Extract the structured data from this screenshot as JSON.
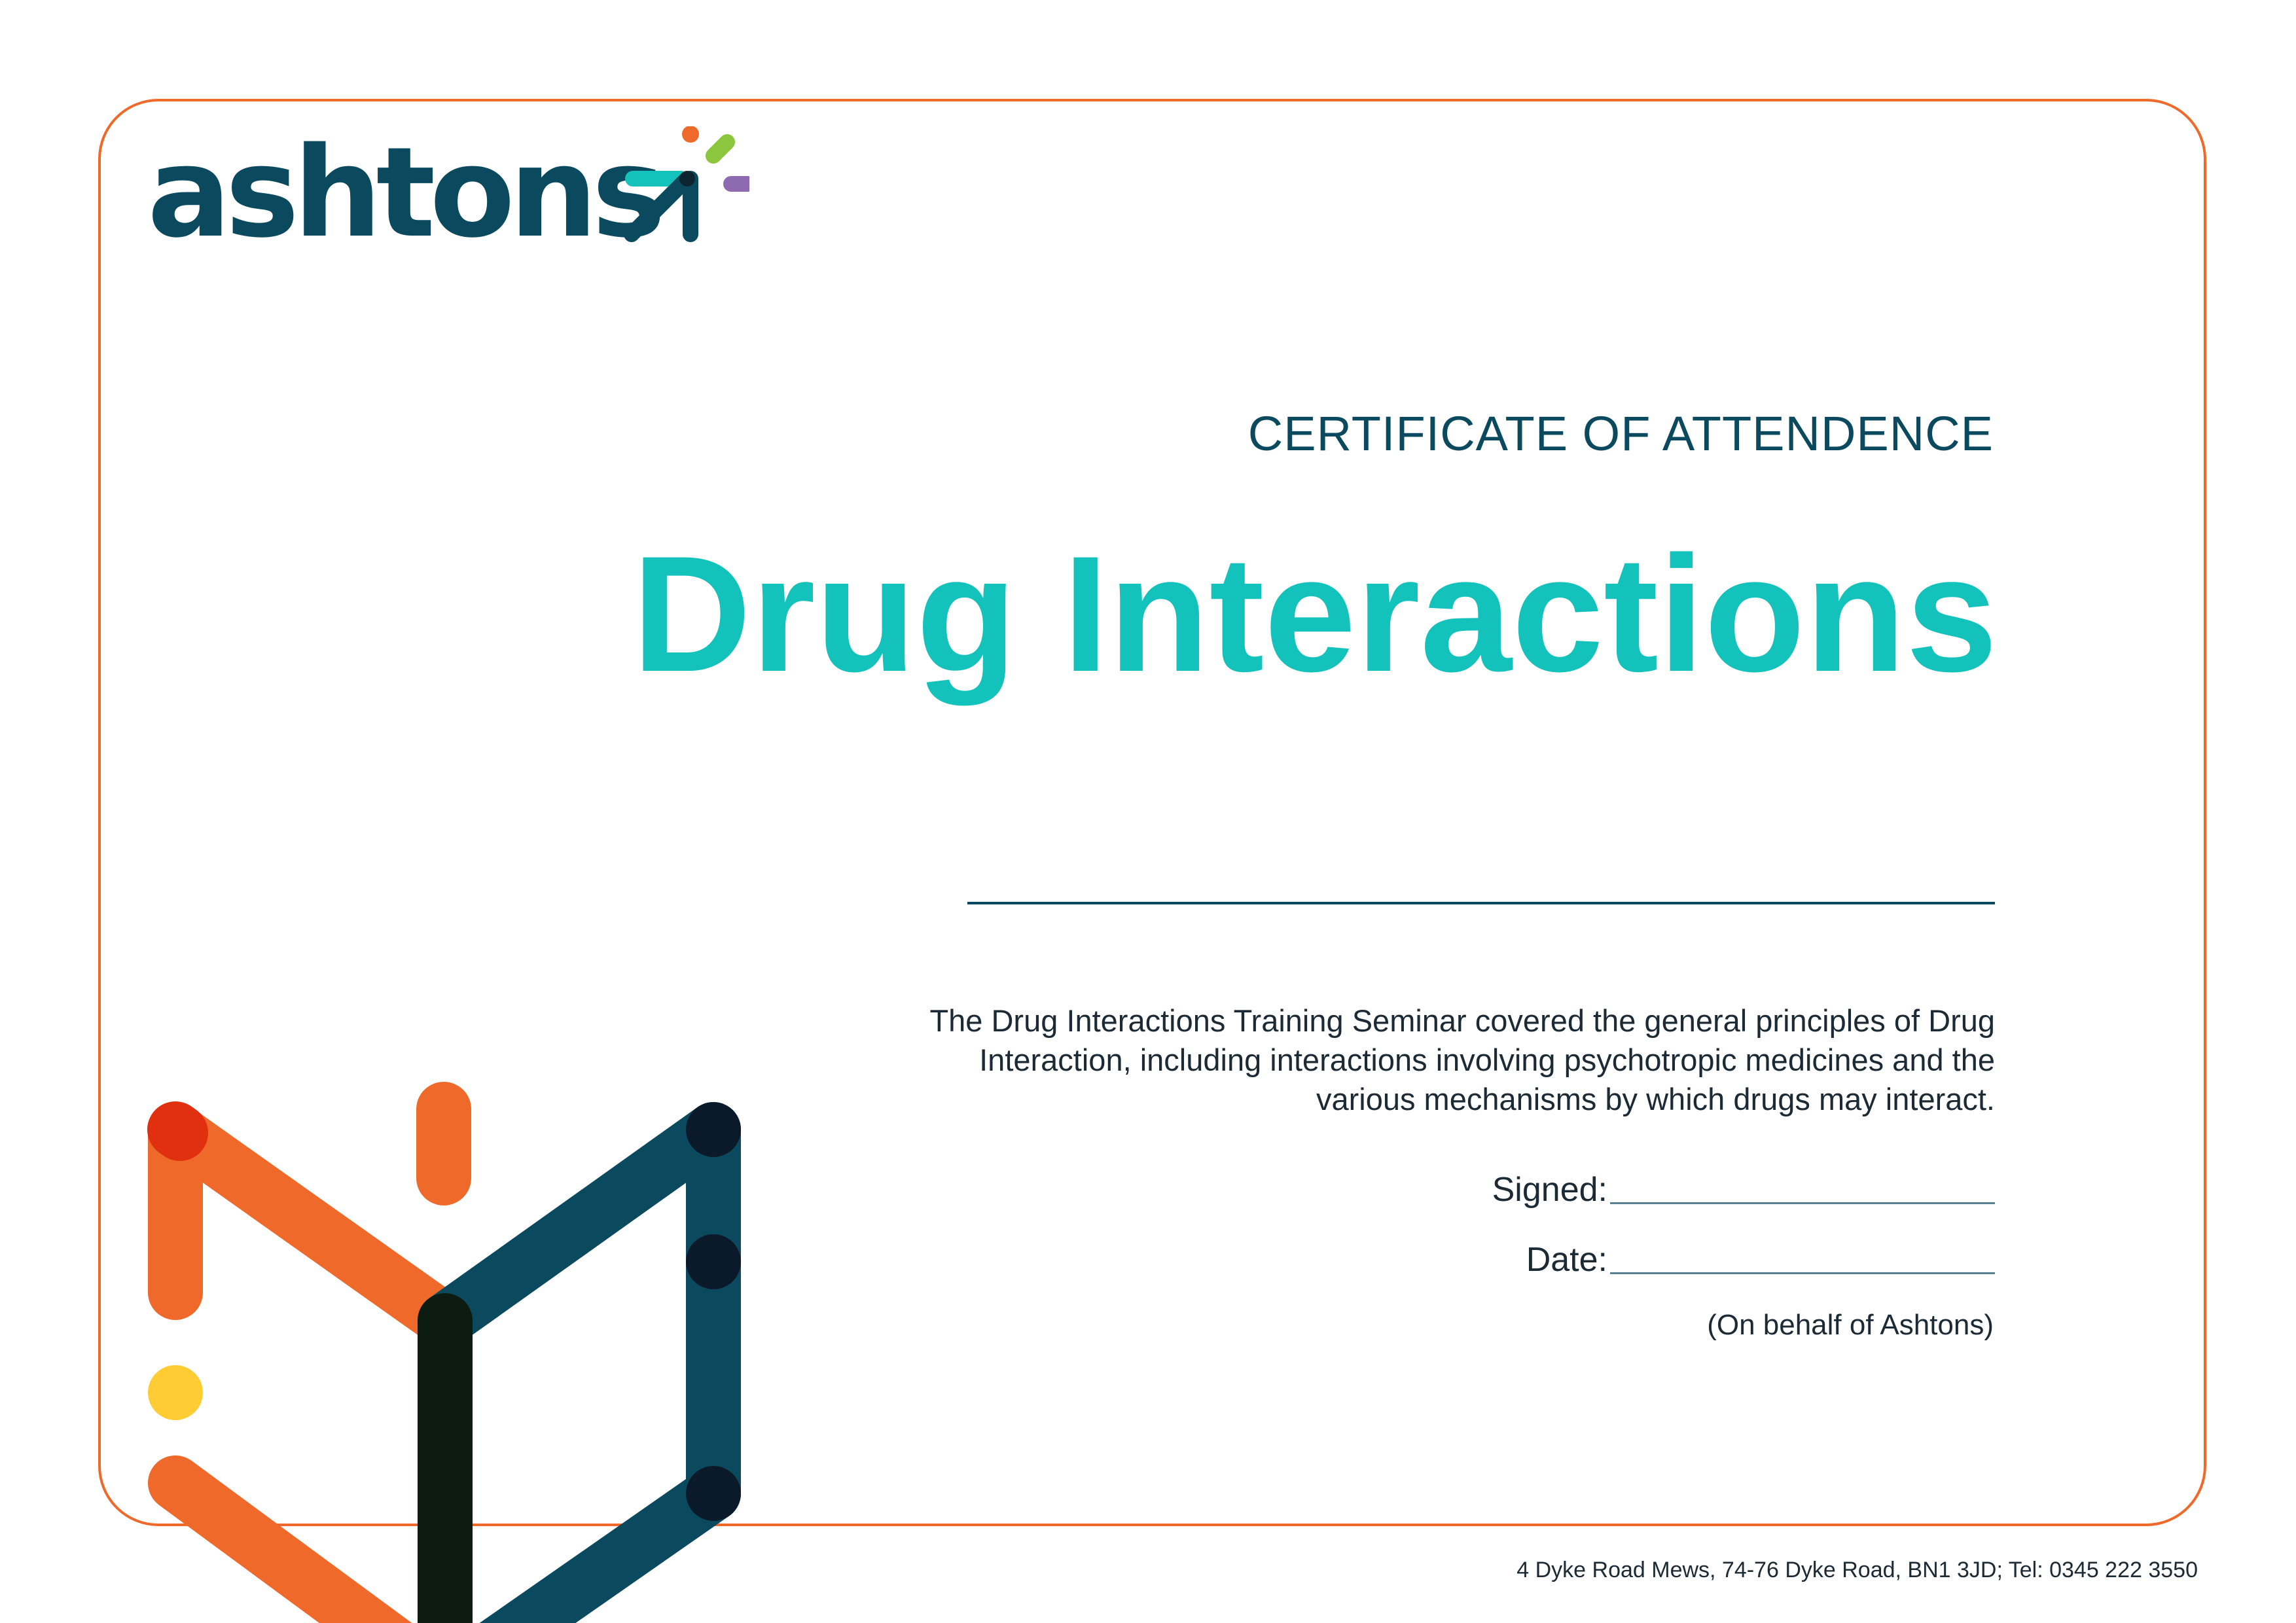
{
  "brand": {
    "name": "ashtons",
    "colors": {
      "navy": "#0b4a5e",
      "teal": "#13c2ba",
      "orange": "#ef6a2a",
      "red": "#e0300f",
      "yellow": "#ffcc33",
      "green": "#8cc63f",
      "purple": "#8e6bb0",
      "dark": "#0c1c10"
    }
  },
  "certificate": {
    "heading": "CERTIFICATE OF ATTENDENCE",
    "course_title": "Drug Interactions",
    "description": "The Drug Interactions Training Seminar covered the general principles of Drug Interaction, including interactions involving psychotropic medicines and the various mechanisms by which drugs may interact.",
    "signed_label": "Signed:",
    "date_label": "Date:",
    "behalf": "(On behalf of Ashtons)"
  },
  "footer": {
    "address": "4 Dyke Road Mews, 74-76 Dyke Road, BN1 3JD; Tel: 0345 222 3550"
  }
}
